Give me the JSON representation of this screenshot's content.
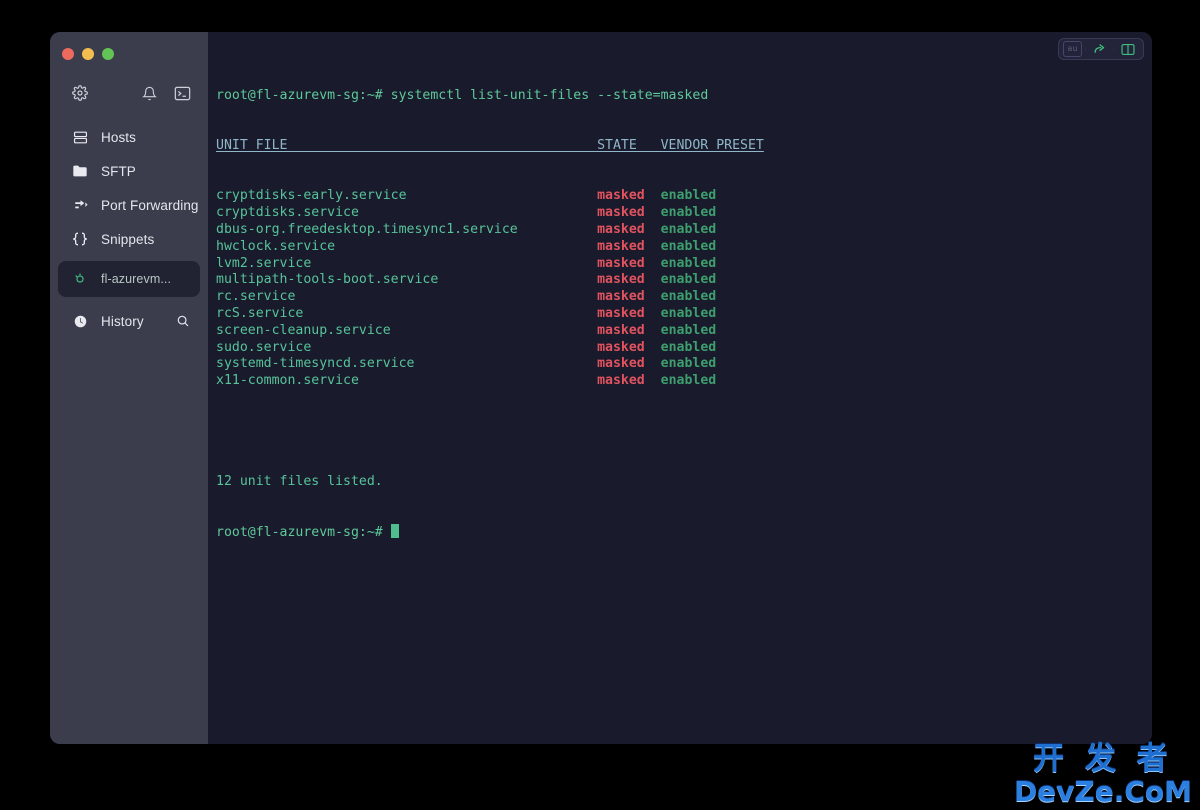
{
  "window": {
    "traffic_lights": [
      {
        "name": "close",
        "color": "#ed6a5e"
      },
      {
        "name": "minimize",
        "color": "#f4bd4f"
      },
      {
        "name": "maximize",
        "color": "#61c454"
      }
    ]
  },
  "sidebar": {
    "toolbar": [
      {
        "icon": "gear-icon"
      },
      {
        "icon": "bell-icon"
      },
      {
        "icon": "terminal-icon"
      }
    ],
    "items": [
      {
        "label": "Hosts",
        "icon": "server-icon"
      },
      {
        "label": "SFTP",
        "icon": "folder-icon"
      },
      {
        "label": "Port Forwarding",
        "icon": "arrows-icon"
      },
      {
        "label": "Snippets",
        "icon": "braces-icon"
      },
      {
        "label": "fl-azurevm...",
        "icon": "session-icon",
        "active": true
      },
      {
        "label": "History",
        "icon": "clock-icon",
        "action_icon": "search-icon"
      }
    ]
  },
  "terminal": {
    "controls": {
      "chip_label": "au",
      "share_icon": "share-arrow-icon",
      "split_icon": "split-pane-icon",
      "accent_color": "#3fbf7f"
    },
    "colors": {
      "background": "#191a2b",
      "prompt": "#5ec99a",
      "unit": "#57c39a",
      "header": "#8fb6c9",
      "masked": "#e0535f",
      "enabled": "#3e9f6e"
    },
    "prompt": "root@fl-azurevm-sg:~#",
    "command": " systemctl list-unit-files --state=masked",
    "table": {
      "col_unit_header": "UNIT FILE",
      "col_state_header": "STATE",
      "col_preset_header": "VENDOR PRESET",
      "header_line": "UNIT FILE                                       STATE   VENDOR PRESET",
      "rows": [
        {
          "unit": "cryptdisks-early.service",
          "state": "masked",
          "preset": "enabled"
        },
        {
          "unit": "cryptdisks.service",
          "state": "masked",
          "preset": "enabled"
        },
        {
          "unit": "dbus-org.freedesktop.timesync1.service",
          "state": "masked",
          "preset": "enabled"
        },
        {
          "unit": "hwclock.service",
          "state": "masked",
          "preset": "enabled"
        },
        {
          "unit": "lvm2.service",
          "state": "masked",
          "preset": "enabled"
        },
        {
          "unit": "multipath-tools-boot.service",
          "state": "masked",
          "preset": "enabled"
        },
        {
          "unit": "rc.service",
          "state": "masked",
          "preset": "enabled"
        },
        {
          "unit": "rcS.service",
          "state": "masked",
          "preset": "enabled"
        },
        {
          "unit": "screen-cleanup.service",
          "state": "masked",
          "preset": "enabled"
        },
        {
          "unit": "sudo.service",
          "state": "masked",
          "preset": "enabled"
        },
        {
          "unit": "systemd-timesyncd.service",
          "state": "masked",
          "preset": "enabled"
        },
        {
          "unit": "x11-common.service",
          "state": "masked",
          "preset": "enabled"
        }
      ]
    },
    "summary": "12 unit files listed.",
    "final_prompt": "root@fl-azurevm-sg:~#"
  },
  "watermark": {
    "line1": "开 发 者",
    "line2": "DevZe.CoM"
  }
}
